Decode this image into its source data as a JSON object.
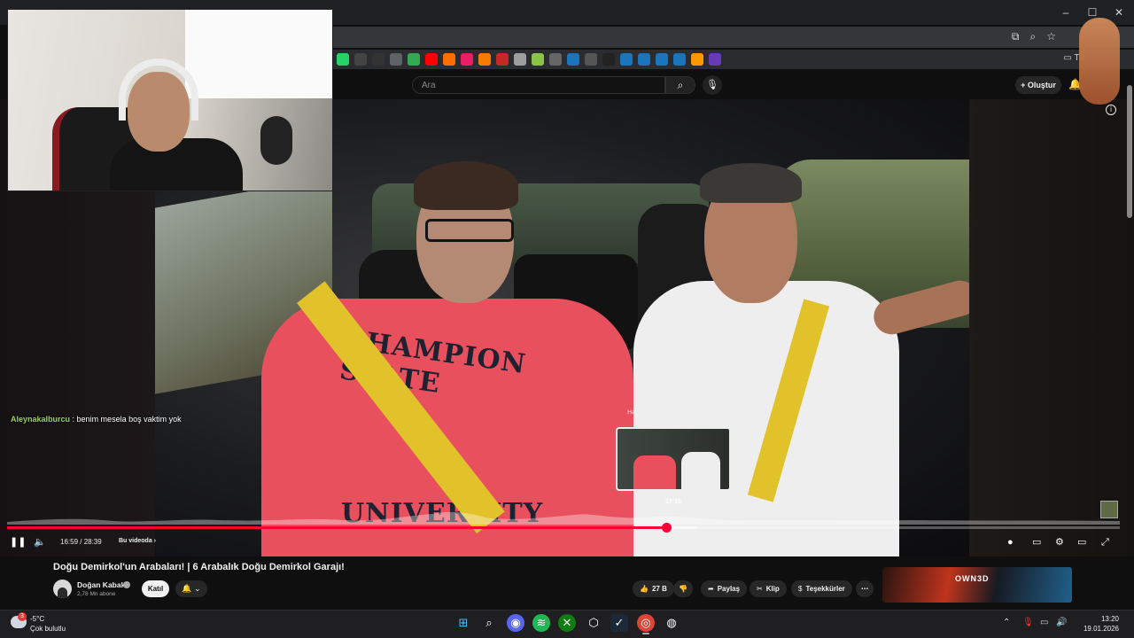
{
  "browser": {
    "window_controls": {
      "minimize": "–",
      "maximize": "☐",
      "close": "✕"
    },
    "bookmark_folder_label": "Tü"
  },
  "youtube_header": {
    "search_placeholder": "Ara",
    "search_icon": "search-icon",
    "mic_icon": "mic-icon",
    "create_label": "Oluştur",
    "bell_icon": "bell-icon"
  },
  "chat_overlay": {
    "username": "Aleynakalburcu",
    "message": "benim mesela boş vaktim yok"
  },
  "player": {
    "hover_hint": "Hassas sarma işlemi için ekranı yukarı kaydırın",
    "preview_time": "17:10",
    "current_time": "16:59",
    "duration": "28:39",
    "time_display": "16:59 / 28:39",
    "chapter_label": "Bu videoda",
    "progress_fraction": 0.5927,
    "buffer_fraction": 0.62,
    "accent_color": "#ff0033"
  },
  "video": {
    "title": "Doğu Demirkol'un Arabaları! | 6 Arabalık Doğu Demirkol Garajı!",
    "shirt_print": [
      "CHAMPION STATE",
      "UNIVERSITY"
    ],
    "channel": {
      "name": "Doğan Kabak",
      "subscribers": "2,78 Mn abone",
      "join_label": "Katıl"
    },
    "actions": {
      "likes": "27 B",
      "share_label": "Paylaş",
      "clip_label": "Klip",
      "thanks_label": "Teşekkürler"
    }
  },
  "ad_banner": {
    "brand": "OWN3D"
  },
  "taskbar": {
    "weather": {
      "badge": "3",
      "temperature": "-5°C",
      "description": "Çok bulutlu"
    },
    "time": "13:20",
    "date": "19.01.2026"
  }
}
